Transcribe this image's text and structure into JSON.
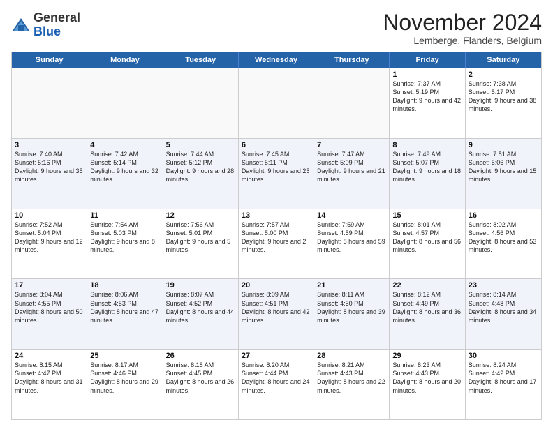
{
  "logo": {
    "general": "General",
    "blue": "Blue"
  },
  "header": {
    "month": "November 2024",
    "location": "Lemberge, Flanders, Belgium"
  },
  "days_of_week": [
    "Sunday",
    "Monday",
    "Tuesday",
    "Wednesday",
    "Thursday",
    "Friday",
    "Saturday"
  ],
  "rows": [
    [
      {
        "day": "",
        "info": "",
        "empty": true
      },
      {
        "day": "",
        "info": "",
        "empty": true
      },
      {
        "day": "",
        "info": "",
        "empty": true
      },
      {
        "day": "",
        "info": "",
        "empty": true
      },
      {
        "day": "",
        "info": "",
        "empty": true
      },
      {
        "day": "1",
        "info": "Sunrise: 7:37 AM\nSunset: 5:19 PM\nDaylight: 9 hours and 42 minutes."
      },
      {
        "day": "2",
        "info": "Sunrise: 7:38 AM\nSunset: 5:17 PM\nDaylight: 9 hours and 38 minutes."
      }
    ],
    [
      {
        "day": "3",
        "info": "Sunrise: 7:40 AM\nSunset: 5:16 PM\nDaylight: 9 hours and 35 minutes."
      },
      {
        "day": "4",
        "info": "Sunrise: 7:42 AM\nSunset: 5:14 PM\nDaylight: 9 hours and 32 minutes."
      },
      {
        "day": "5",
        "info": "Sunrise: 7:44 AM\nSunset: 5:12 PM\nDaylight: 9 hours and 28 minutes."
      },
      {
        "day": "6",
        "info": "Sunrise: 7:45 AM\nSunset: 5:11 PM\nDaylight: 9 hours and 25 minutes."
      },
      {
        "day": "7",
        "info": "Sunrise: 7:47 AM\nSunset: 5:09 PM\nDaylight: 9 hours and 21 minutes."
      },
      {
        "day": "8",
        "info": "Sunrise: 7:49 AM\nSunset: 5:07 PM\nDaylight: 9 hours and 18 minutes."
      },
      {
        "day": "9",
        "info": "Sunrise: 7:51 AM\nSunset: 5:06 PM\nDaylight: 9 hours and 15 minutes."
      }
    ],
    [
      {
        "day": "10",
        "info": "Sunrise: 7:52 AM\nSunset: 5:04 PM\nDaylight: 9 hours and 12 minutes."
      },
      {
        "day": "11",
        "info": "Sunrise: 7:54 AM\nSunset: 5:03 PM\nDaylight: 9 hours and 8 minutes."
      },
      {
        "day": "12",
        "info": "Sunrise: 7:56 AM\nSunset: 5:01 PM\nDaylight: 9 hours and 5 minutes."
      },
      {
        "day": "13",
        "info": "Sunrise: 7:57 AM\nSunset: 5:00 PM\nDaylight: 9 hours and 2 minutes."
      },
      {
        "day": "14",
        "info": "Sunrise: 7:59 AM\nSunset: 4:59 PM\nDaylight: 8 hours and 59 minutes."
      },
      {
        "day": "15",
        "info": "Sunrise: 8:01 AM\nSunset: 4:57 PM\nDaylight: 8 hours and 56 minutes."
      },
      {
        "day": "16",
        "info": "Sunrise: 8:02 AM\nSunset: 4:56 PM\nDaylight: 8 hours and 53 minutes."
      }
    ],
    [
      {
        "day": "17",
        "info": "Sunrise: 8:04 AM\nSunset: 4:55 PM\nDaylight: 8 hours and 50 minutes."
      },
      {
        "day": "18",
        "info": "Sunrise: 8:06 AM\nSunset: 4:53 PM\nDaylight: 8 hours and 47 minutes."
      },
      {
        "day": "19",
        "info": "Sunrise: 8:07 AM\nSunset: 4:52 PM\nDaylight: 8 hours and 44 minutes."
      },
      {
        "day": "20",
        "info": "Sunrise: 8:09 AM\nSunset: 4:51 PM\nDaylight: 8 hours and 42 minutes."
      },
      {
        "day": "21",
        "info": "Sunrise: 8:11 AM\nSunset: 4:50 PM\nDaylight: 8 hours and 39 minutes."
      },
      {
        "day": "22",
        "info": "Sunrise: 8:12 AM\nSunset: 4:49 PM\nDaylight: 8 hours and 36 minutes."
      },
      {
        "day": "23",
        "info": "Sunrise: 8:14 AM\nSunset: 4:48 PM\nDaylight: 8 hours and 34 minutes."
      }
    ],
    [
      {
        "day": "24",
        "info": "Sunrise: 8:15 AM\nSunset: 4:47 PM\nDaylight: 8 hours and 31 minutes."
      },
      {
        "day": "25",
        "info": "Sunrise: 8:17 AM\nSunset: 4:46 PM\nDaylight: 8 hours and 29 minutes."
      },
      {
        "day": "26",
        "info": "Sunrise: 8:18 AM\nSunset: 4:45 PM\nDaylight: 8 hours and 26 minutes."
      },
      {
        "day": "27",
        "info": "Sunrise: 8:20 AM\nSunset: 4:44 PM\nDaylight: 8 hours and 24 minutes."
      },
      {
        "day": "28",
        "info": "Sunrise: 8:21 AM\nSunset: 4:43 PM\nDaylight: 8 hours and 22 minutes."
      },
      {
        "day": "29",
        "info": "Sunrise: 8:23 AM\nSunset: 4:43 PM\nDaylight: 8 hours and 20 minutes."
      },
      {
        "day": "30",
        "info": "Sunrise: 8:24 AM\nSunset: 4:42 PM\nDaylight: 8 hours and 17 minutes."
      }
    ]
  ]
}
